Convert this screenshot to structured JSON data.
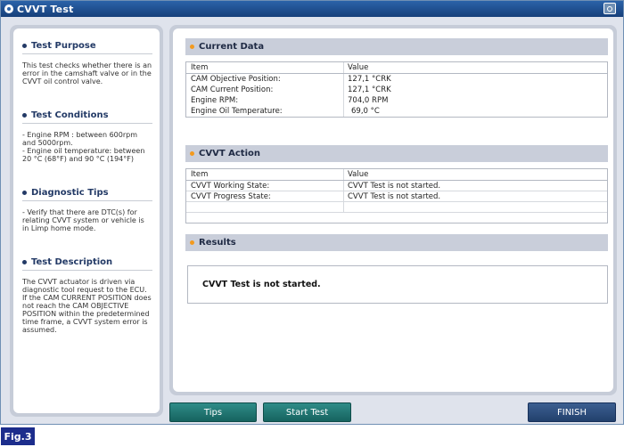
{
  "window": {
    "title": "CVVT Test"
  },
  "left": {
    "sections": [
      {
        "heading": "Test Purpose",
        "body": "This test checks whether there is an error in the camshaft valve or in the CVVT oil control valve."
      },
      {
        "heading": "Test Conditions",
        "body": "- Engine RPM : between 600rpm and 5000rpm.\n- Engine oil temperature: between 20 °C (68°F) and 90 °C (194°F)"
      },
      {
        "heading": "Diagnostic Tips",
        "body": "- Verify that there are DTC(s) for relating CVVT system or vehicle is in Limp home mode."
      },
      {
        "heading": "Test Description",
        "body": "The CVVT actuator is driven via diagnostic tool request to the ECU.\nIf the CAM CURRENT POSITION does not reach the CAM OBJECTIVE POSITION within the predetermined time frame, a CVVT system error is assumed."
      }
    ]
  },
  "current_data": {
    "title": "Current Data",
    "col_item": "Item",
    "col_value": "Value",
    "rows": [
      {
        "item": "CAM Objective Position:",
        "value": "127,1 °CRK"
      },
      {
        "item": "CAM Current Position:",
        "value": "127,1 °CRK"
      },
      {
        "item": "Engine RPM:",
        "value": "704,0 RPM"
      },
      {
        "item": "Engine Oil Temperature:",
        "value": "69,0 °C"
      }
    ]
  },
  "cvvt_action": {
    "title": "CVVT Action",
    "col_item": "Item",
    "col_value": "Value",
    "rows": [
      {
        "item": "CVVT Working State:",
        "value": "CVVT Test is not started."
      },
      {
        "item": "CVVT Progress State:",
        "value": "CVVT Test is not started."
      }
    ]
  },
  "results": {
    "title": "Results",
    "message": "CVVT Test is not started."
  },
  "buttons": {
    "tips": "Tips",
    "start": "Start Test",
    "finish": "FINISH"
  },
  "figure_label": "Fig.3",
  "colors": {
    "titlebar": "#1f4f91",
    "accent_dot": "#f39a1e",
    "teal_button": "#1f7a76",
    "navy_button": "#2c4d7e",
    "fig_label": "#1c2d8c"
  },
  "icons": {
    "title": "app-icon",
    "camera": "camera-icon"
  }
}
